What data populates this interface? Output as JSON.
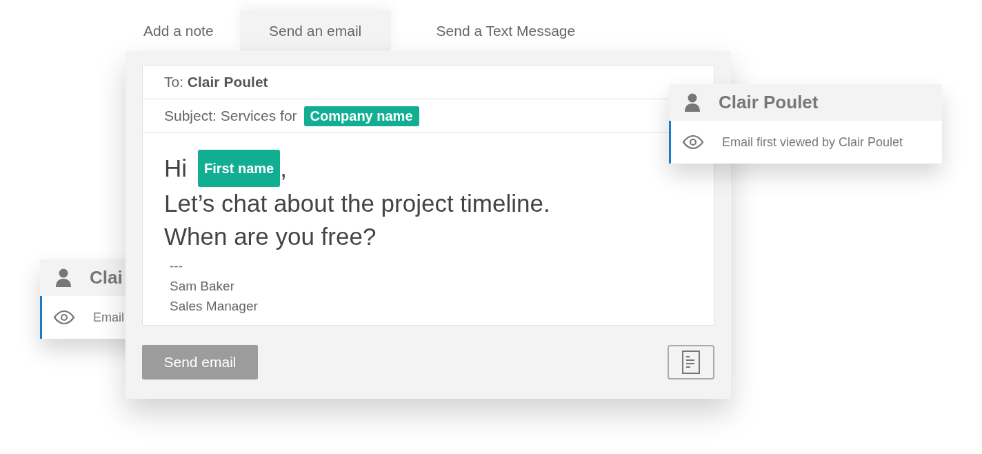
{
  "tabs": [
    {
      "label": "Add a note",
      "selected": false
    },
    {
      "label": "Send an email",
      "selected": true
    },
    {
      "label": "Send a Text Message",
      "selected": false
    }
  ],
  "email": {
    "to": "To: **Clair Poulet**",
    "subject_label": "Subject: Services for",
    "subject_tag": "Company name",
    "greeting": "Hi",
    "greeting_tag": "First name",
    "greeting_end": ",",
    "body_lines": [
      "Let’s chat about the project timeline.",
      "When are you free?"
    ],
    "signature": [
      "---",
      "Sam Baker",
      "Sales Manager"
    ]
  },
  "send_button": {
    "label": "Send email",
    "disabled": true
  },
  "notifications": [
    {
      "name": "Clair Poulet",
      "event": "Email first viewed by Clair Poulet"
    },
    {
      "name": "Clai",
      "event": "Email"
    }
  ]
}
